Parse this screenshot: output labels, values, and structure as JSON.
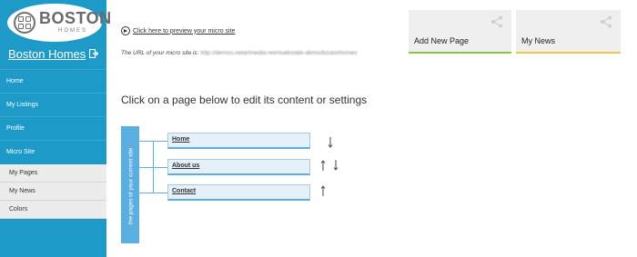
{
  "sidebar": {
    "logo": {
      "text": "BOSTON",
      "sub": "HOMES"
    },
    "site_name": "Boston Homes",
    "nav": [
      {
        "label": "Home"
      },
      {
        "label": "My Listings"
      },
      {
        "label": "Profile"
      },
      {
        "label": "Micro Site"
      }
    ],
    "submenu": [
      {
        "label": "My Pages"
      },
      {
        "label": "My News"
      },
      {
        "label": "Colors"
      }
    ]
  },
  "main": {
    "preview_link": "Click here to preview your micro site",
    "url_prefix": "The URL of your micro site is: ",
    "url_value": "http://demos.netartmedia.net/realestate-demo/bostonhomes",
    "instruction": "Click on a page below to edit its content or settings",
    "vertical_label": "the pages of your current site",
    "pages": [
      {
        "label": "Home"
      },
      {
        "label": "About us"
      },
      {
        "label": "Contact"
      }
    ]
  },
  "tiles": [
    {
      "label": "Add New Page",
      "icon": "share-icon",
      "accent": "#8cc63f"
    },
    {
      "label": "My News",
      "icon": "share-icon",
      "accent": "#e8c84a"
    }
  ],
  "colors": {
    "sidebar": "#1d9ac7",
    "accent_blue": "#5aaee0",
    "tile_bg": "#efefef"
  }
}
